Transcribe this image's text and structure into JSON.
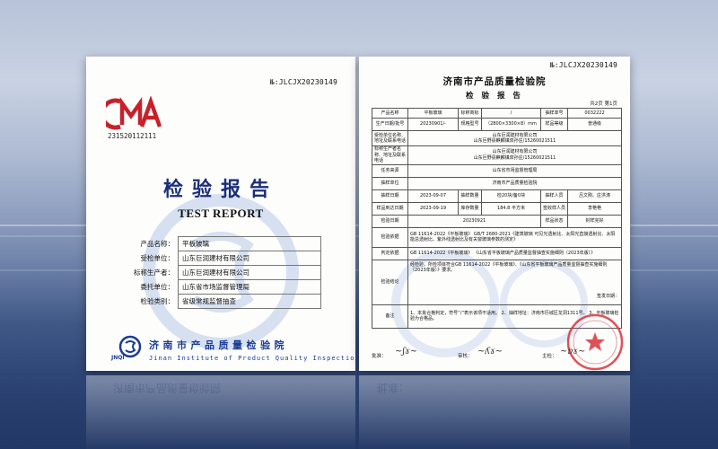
{
  "report_no": "№:JLCJX20230149",
  "cover": {
    "cert_no": "231520112111",
    "cma_letters": "CMA",
    "title_cn": "检验报告",
    "title_en": "TEST REPORT",
    "fields": [
      {
        "label": "产品名称：",
        "value": "平板玻璃"
      },
      {
        "label": "受检单位：",
        "value": "山东巨润建材有限公司"
      },
      {
        "label": "标称生产者：",
        "value": "山东巨润建材有限公司"
      },
      {
        "label": "委托单位：",
        "value": "山东省市场监督管理局"
      },
      {
        "label": "检验类别：",
        "value": "省级常规监督抽查"
      }
    ],
    "institute_cn": "济南市产品质量检验院",
    "institute_en": "Jinan Institute of Product Quality Inspection",
    "institute_abbr": "JNQI"
  },
  "detail": {
    "institute": "济南市产品质量检验院",
    "title": "检 验 报 告",
    "page_of": "共2页 第1页",
    "rows": {
      "product_name_label": "产品名称",
      "product_name": "平板玻璃",
      "brand_label": "标称商标",
      "brand": "/",
      "sample_no_label": "抽样单号",
      "sample_no": "0032222",
      "date_batch_label": "生产日期/批号",
      "date_batch": "20230901/-",
      "spec_label": "规格型号",
      "spec": "（2800×3300×8）mm",
      "grade_label": "样品等级",
      "grade": "普通级",
      "inspected_label": "受检单位名称、地址及联系电话",
      "inspected": "山东巨润建材有限公司",
      "inspected_addr": "山东巨野县麒麟镇双孙庄/15260021511",
      "producer_label": "标称生产者名称、地址及联系电话",
      "producer": "山东巨润建材有限公司",
      "producer_addr": "山东巨野县麒麟镇双孙庄/15260021511",
      "task_source_label": "任务来源",
      "task_source": "山东省市场监督管理局",
      "sampling_unit_label": "抽样单位",
      "sampling_unit": "济南市产品质量检验院",
      "sampling_date_label": "抽样日期",
      "sampling_date": "2023-09-07",
      "sample_qty_label": "抽样数量",
      "sample_qty": "检20块/备0块",
      "sampler_label": "抽样人员",
      "sampler": "吕文刚、庄洪涛",
      "arrival_date_label": "样品到达日期",
      "arrival_date": "2023-09-19",
      "stock_label": "库存数量",
      "stock": "184.8 平方米",
      "receiver_label": "签收样人员",
      "receiver": "李艳艳",
      "test_date_label": "检验日期",
      "test_date": "20230921",
      "sample_state_label": "样品状态",
      "sample_state": "封样完好",
      "basis_label": "检验依据",
      "basis": "GB 11614-2022《平板玻璃》 GB/T 2680-2021《建筑玻璃 可见光透射比、太阳光直接透射比、太阳能总透射比、紫外线透射比及有关窗玻璃参数的测定》",
      "judge_label": "判定依据",
      "judge": "GB 11614-2022《平板玻璃》 《山东省平板玻璃产品质量监督抽查实施细则（2023年版）》",
      "conclusion_label": "检验结论",
      "conclusion": "经检验，所检项目符合GB 11614-2022《平板玻璃》、《山东省平板玻璃产品质量监督抽查实施细则（2023年版）》要求。",
      "issue_date": "签发日期：",
      "remarks_label": "备注",
      "remarks": "1、本批合格判定，符号“/”表示该项不适用。 2、抽样地址：济南市历城区龙洞1311号。 3、平板玻璃检验为合格品。"
    },
    "sign_labels": {
      "approver": "批准：",
      "reviewer": "审核：",
      "editor": "主检："
    }
  },
  "colors": {
    "brand_blue": "#1b3c96",
    "cma_red": "#c8202a",
    "stamp_red": "#d8343a"
  },
  "icons": [
    "cma-mark",
    "jnqi-logo",
    "official-stamp"
  ]
}
